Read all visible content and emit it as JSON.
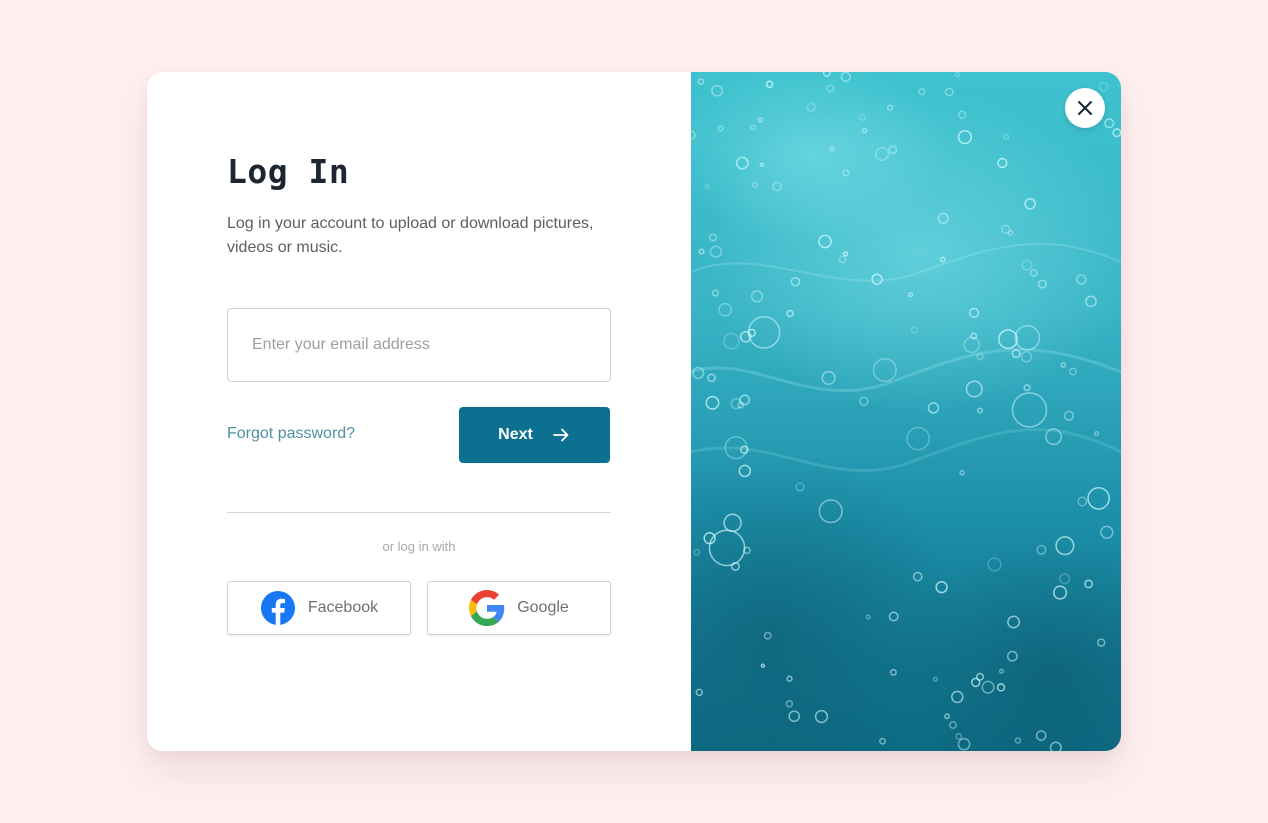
{
  "login": {
    "title": "Log In",
    "subtitle": "Log in your account to upload or download pictures, videos or music.",
    "email_placeholder": "Enter your email address",
    "forgot_password": "Forgot password?",
    "next_label": "Next",
    "alt_label": "or log in with",
    "facebook_label": "Facebook",
    "google_label": "Google"
  },
  "colors": {
    "background": "#fff0f0",
    "primary": "#0c7190",
    "link": "#4e8fa3",
    "title": "#1c2530"
  },
  "icons": {
    "next": "arrow-right-icon",
    "close": "close-icon",
    "facebook": "facebook-icon",
    "google": "google-icon"
  }
}
